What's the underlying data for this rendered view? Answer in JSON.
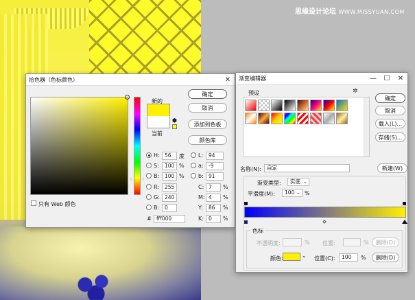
{
  "watermark": {
    "text": "思缘设计论坛",
    "site": "WWW.MISSYUAN.COM"
  },
  "picker": {
    "title": "拾色器（色标颜色）",
    "new_label": "新的",
    "current_label": "当前",
    "ok": "确定",
    "cancel": "取消",
    "add_swatch": "添加到色板",
    "libraries": "颜色库",
    "web_only": "只有 Web 颜色",
    "new_color": "#fff000",
    "current_color": "#ffffff",
    "fields": {
      "H": "56",
      "H_unit": "度",
      "S": "100",
      "S_unit": "%",
      "Bv": "100",
      "Bv_unit": "%",
      "R": "255",
      "G": "240",
      "B": "0",
      "L": "94",
      "a": "-9",
      "b": "91",
      "C": "7",
      "M": "4",
      "Y": "86",
      "K": "0",
      "hex": "fff000",
      "pct": "%"
    },
    "labels": {
      "H": "H:",
      "S": "S:",
      "Bv": "B:",
      "R": "R:",
      "G": "G:",
      "B": "B:",
      "L": "L:",
      "a": "a:",
      "b": "b:",
      "C": "C:",
      "M": "M:",
      "Y": "Y:",
      "K": "K:",
      "hash": "#"
    }
  },
  "gradient": {
    "title": "渐变编辑器",
    "presets": "预设",
    "ok": "确定",
    "cancel": "取消",
    "load": "载入(L)...",
    "save": "存储(S)...",
    "name_label": "名称(N):",
    "name_value": "自定",
    "new": "新建(W)",
    "type_label": "渐变类型:",
    "type_value": "实底",
    "smooth_label": "平滑度(M):",
    "smooth_value": "100",
    "smooth_unit": "%",
    "stops_title": "色标",
    "opacity_label": "不透明度:",
    "opacity_unit": "%",
    "position_label": "位置:",
    "position_unit": "%",
    "delete": "删除(D)",
    "color_label": "颜色:",
    "position_c_label": "位置(C):",
    "position_c_value": "100",
    "delete_c": "删除(D)",
    "stop_color": "#fff000"
  }
}
